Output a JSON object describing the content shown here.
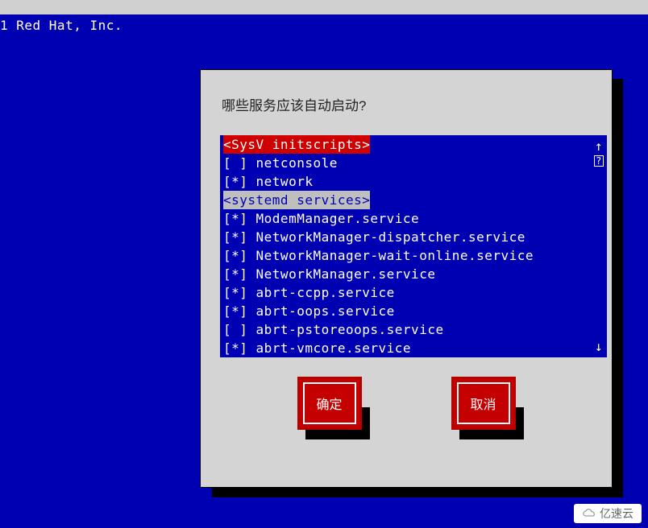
{
  "vendor_line": "1 Red Hat, Inc.",
  "dialog": {
    "title": "哪些服务应该自动启动?",
    "ok_label": "确定",
    "cancel_label": "取消"
  },
  "sections": {
    "sysv_header": "<SysV initscripts>",
    "systemd_header": "<systemd services>"
  },
  "services": [
    {
      "checked": false,
      "name": "netconsole"
    },
    {
      "checked": true,
      "name": "network"
    },
    {
      "checked": true,
      "name": "ModemManager.service"
    },
    {
      "checked": true,
      "name": "NetworkManager-dispatcher.service"
    },
    {
      "checked": true,
      "name": "NetworkManager-wait-online.service"
    },
    {
      "checked": true,
      "name": "NetworkManager.service"
    },
    {
      "checked": true,
      "name": "abrt-ccpp.service"
    },
    {
      "checked": true,
      "name": "abrt-oops.service"
    },
    {
      "checked": false,
      "name": "abrt-pstoreoops.service"
    },
    {
      "checked": true,
      "name": "abrt-vmcore.service"
    }
  ],
  "scroll": {
    "up": "↑",
    "down": "↓",
    "help": "?"
  },
  "watermark": "亿速云"
}
